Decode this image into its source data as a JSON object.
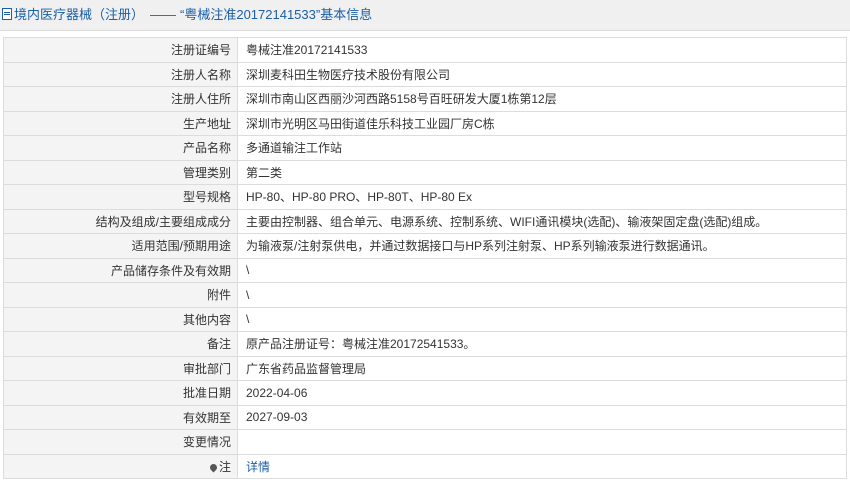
{
  "header": {
    "title": "境内医疗器械（注册）",
    "separator": "——",
    "subtitle": "“粤械注准20172141533”基本信息"
  },
  "rows": [
    {
      "label": "注册证编号",
      "value": "粤械注准20172141533"
    },
    {
      "label": "注册人名称",
      "value": "深圳麦科田生物医疗技术股份有限公司"
    },
    {
      "label": "注册人住所",
      "value": "深圳市南山区西丽沙河西路5158号百旺研发大厦1栋第12层"
    },
    {
      "label": "生产地址",
      "value": "深圳市光明区马田街道佳乐科技工业园厂房C栋"
    },
    {
      "label": "产品名称",
      "value": "多通道输注工作站"
    },
    {
      "label": "管理类别",
      "value": "第二类"
    },
    {
      "label": "型号规格",
      "value": "HP-80、HP-80 PRO、HP-80T、HP-80 Ex"
    },
    {
      "label": "结构及组成/主要组成成分",
      "value": "主要由控制器、组合单元、电源系统、控制系统、WIFI通讯模块(选配)、输液架固定盘(选配)组成。"
    },
    {
      "label": "适用范围/预期用途",
      "value": "为输液泵/注射泵供电，并通过数据接口与HP系列注射泵、HP系列输液泵进行数据通讯。"
    },
    {
      "label": "产品储存条件及有效期",
      "value": "\\"
    },
    {
      "label": "附件",
      "value": "\\"
    },
    {
      "label": "其他内容",
      "value": "\\"
    },
    {
      "label": "备注",
      "value": "原产品注册证号：粤械注准20172541533。"
    },
    {
      "label": "审批部门",
      "value": "广东省药品监督管理局"
    },
    {
      "label": "批准日期",
      "value": "2022-04-06"
    },
    {
      "label": "有效期至",
      "value": "2027-09-03"
    },
    {
      "label": "变更情况",
      "value": ""
    }
  ],
  "note_row": {
    "label": "注",
    "link": "详情"
  },
  "icons": {
    "header": "document-icon",
    "note": "pin-icon"
  },
  "colors": {
    "link": "#1a5fa8",
    "label_bg": "#f4f4f4",
    "border": "#dcdcdc"
  }
}
